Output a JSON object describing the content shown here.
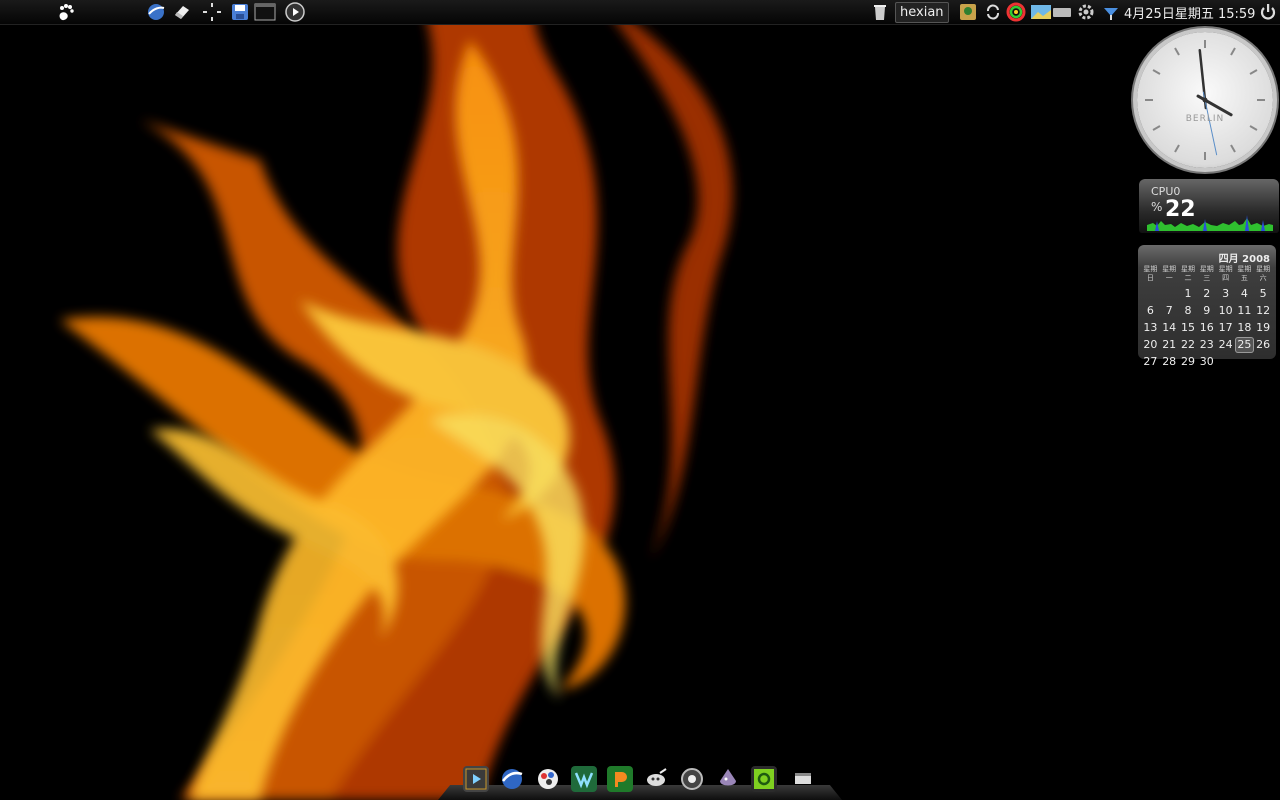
{
  "top_panel": {
    "username": "hexian",
    "datetime": "4月25日星期五 15:59"
  },
  "clock_widget": {
    "city": "BERLIN",
    "time": "15:59"
  },
  "cpu_widget": {
    "label": "CPU0",
    "unit": "%",
    "value": "22"
  },
  "calendar_widget": {
    "title": "四月 2008",
    "weekday_headers": [
      "星期日",
      "星期一",
      "星期二",
      "星期三",
      "星期四",
      "星期五",
      "星期六"
    ],
    "days": [
      "",
      "",
      "1",
      "2",
      "3",
      "4",
      "5",
      "6",
      "7",
      "8",
      "9",
      "10",
      "11",
      "12",
      "13",
      "14",
      "15",
      "16",
      "17",
      "18",
      "19",
      "20",
      "21",
      "22",
      "23",
      "24",
      "25",
      "26",
      "27",
      "28",
      "29",
      "30"
    ],
    "today": "25"
  },
  "icons": {
    "launcher_left": [
      "gnome-foot-icon"
    ],
    "launcher_apps": [
      "web-browser-icon",
      "eraser-icon",
      "workspace-icon",
      "save-icon",
      "terminal-icon",
      "media-play-icon"
    ],
    "tray": [
      "trash-icon",
      "update-manager-icon",
      "refresh-icon",
      "color-wheel-icon",
      "picture-icon",
      "keyboard-icon",
      "settings-icon",
      "network-icon",
      "power-icon"
    ],
    "dock": [
      "video-player-icon",
      "web-browser-icon",
      "paint-icon",
      "vmware-icon",
      "presentation-icon",
      "gimp-icon",
      "chrome-icon",
      "inkscape-icon",
      "system-monitor-icon",
      "desktop-switch-icon"
    ]
  },
  "colors": {
    "flame_core": "#fff06a",
    "flame_mid": "#ff9a10",
    "flame_dark": "#8a1e00",
    "cpu_graph_fill": "#2fbf2f",
    "cpu_graph_peak": "#2a4fdc"
  }
}
